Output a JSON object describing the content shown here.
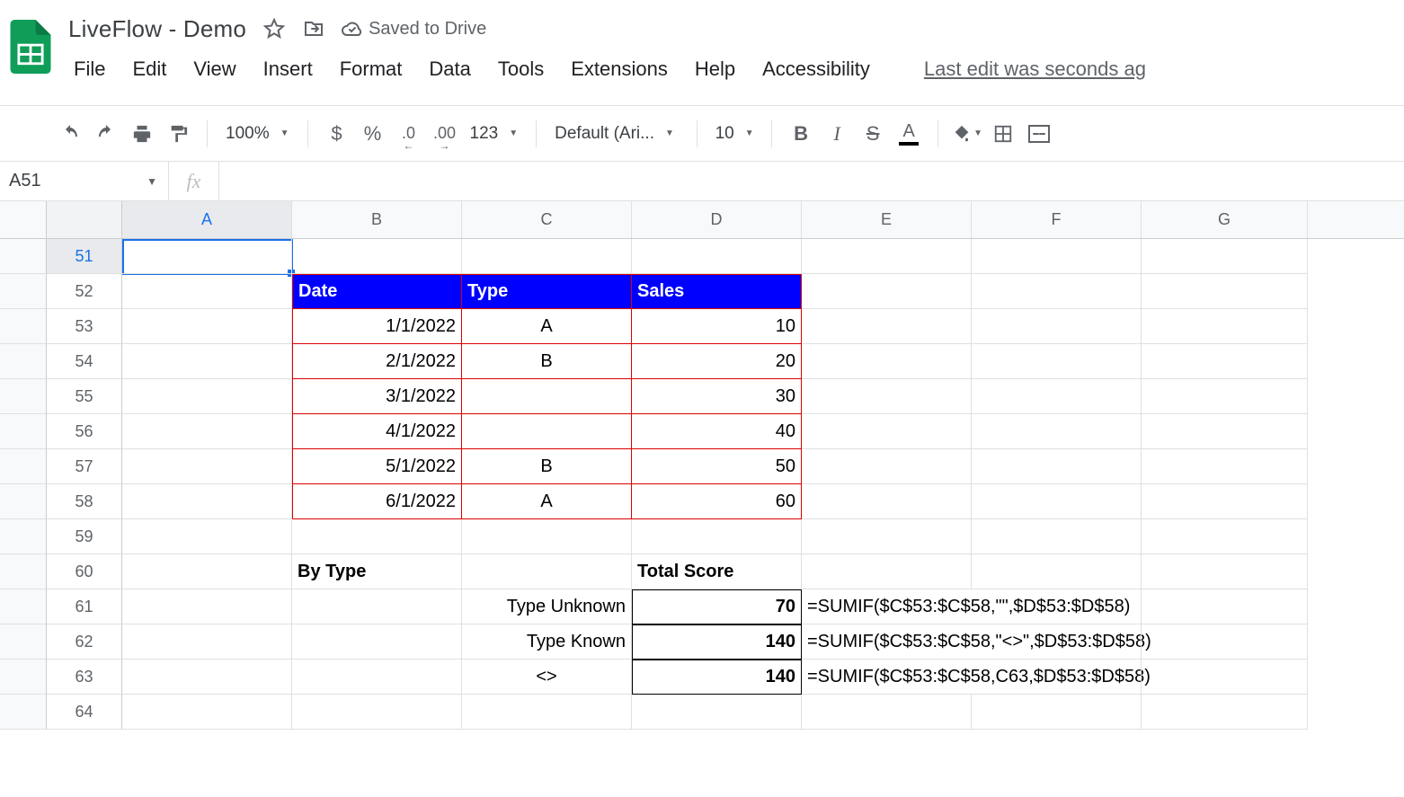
{
  "doc": {
    "title": "LiveFlow - Demo",
    "saved": "Saved to Drive"
  },
  "menu": {
    "file": "File",
    "edit": "Edit",
    "view": "View",
    "insert": "Insert",
    "format": "Format",
    "data": "Data",
    "tools": "Tools",
    "extensions": "Extensions",
    "help": "Help",
    "accessibility": "Accessibility",
    "last_edit": "Last edit was seconds ag"
  },
  "toolbar": {
    "zoom": "100%",
    "currency": "$",
    "percent": "%",
    "dec_dec": ".0",
    "dec_inc": ".00",
    "num_fmt": "123",
    "font": "Default (Ari...",
    "font_size": "10"
  },
  "active_cell": "A51",
  "columns": [
    "A",
    "B",
    "C",
    "D",
    "E",
    "F",
    "G"
  ],
  "rows": [
    "51",
    "52",
    "53",
    "54",
    "55",
    "56",
    "57",
    "58",
    "59",
    "60",
    "61",
    "62",
    "63",
    "64"
  ],
  "table": {
    "headers": {
      "date": "Date",
      "type": "Type",
      "sales": "Sales"
    },
    "data": [
      {
        "date": "1/1/2022",
        "type": "A",
        "sales": "10"
      },
      {
        "date": "2/1/2022",
        "type": "B",
        "sales": "20"
      },
      {
        "date": "3/1/2022",
        "type": "",
        "sales": "30"
      },
      {
        "date": "4/1/2022",
        "type": "",
        "sales": "40"
      },
      {
        "date": "5/1/2022",
        "type": "B",
        "sales": "50"
      },
      {
        "date": "6/1/2022",
        "type": "A",
        "sales": "60"
      }
    ]
  },
  "summary": {
    "by_type": "By Type",
    "total_score": "Total Score",
    "rows": [
      {
        "label": "Type Unknown",
        "value": "70",
        "formula": "=SUMIF($C$53:$C$58,\"\",$D$53:$D$58)"
      },
      {
        "label": "Type Known",
        "value": "140",
        "formula": "=SUMIF($C$53:$C$58,\"<>\",$D$53:$D$58)"
      },
      {
        "label": "<>",
        "value": "140",
        "formula": "=SUMIF($C$53:$C$58,C63,$D$53:$D$58)"
      }
    ]
  }
}
